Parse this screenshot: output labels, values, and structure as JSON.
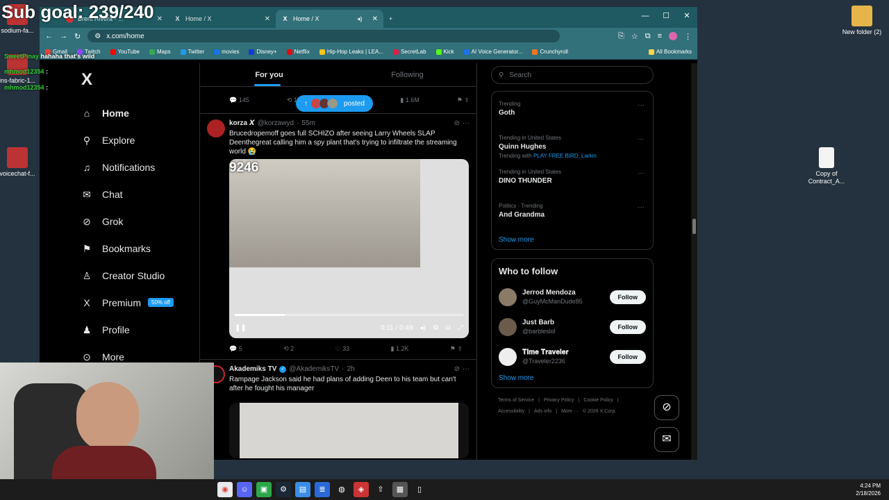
{
  "overlay": {
    "goal": "Sub goal: 239/240",
    "chat": [
      {
        "user": "SweetPinay",
        "msg": "hahaha that's wild"
      },
      {
        "user": "mhmod12354",
        "msg": ":"
      },
      {
        "user": "mhmod12354",
        "msg": ":"
      }
    ]
  },
  "desktop": {
    "icons": [
      "sodium-fa...",
      "ins-fabric-1...",
      "voicechat-f...",
      "New folder (2)",
      "Copy of Contract_A..."
    ]
  },
  "browser": {
    "tabs": [
      {
        "label": "Brent Rivera - ...",
        "active": false
      },
      {
        "label": "Home / X",
        "active": false
      },
      {
        "label": "Home / X",
        "active": true
      }
    ],
    "url": "x.com/home",
    "bookmarks": [
      "Gmail",
      "Twitch",
      "YouTube",
      "Maps",
      "Twitter",
      "movies",
      "Disney+",
      "Netflix",
      "Hip-Hop Leaks | LEA...",
      "SecretLab",
      "Kick",
      "AI Voice Generator...",
      "Crunchyroll",
      "All Bookmarks"
    ],
    "bookmark_colors": [
      "#ea4335",
      "#9146ff",
      "#ff0000",
      "#34a853",
      "#1d9bf0",
      "#1a73e8",
      "#113ccf",
      "#e50914",
      "#f5c518",
      "#e11d48",
      "#53fc18",
      "#1a73e8",
      "#f47521",
      "#ffd54f"
    ]
  },
  "nav": {
    "logo": "X",
    "items": [
      {
        "label": "Home",
        "icon": "home-icon",
        "glyph": "⌂"
      },
      {
        "label": "Explore",
        "icon": "search-icon",
        "glyph": "⚲"
      },
      {
        "label": "Notifications",
        "icon": "bell-icon",
        "glyph": "♫"
      },
      {
        "label": "Chat",
        "icon": "mail-icon",
        "glyph": "✉"
      },
      {
        "label": "Grok",
        "icon": "grok-icon",
        "glyph": "⊘"
      },
      {
        "label": "Bookmarks",
        "icon": "bookmark-icon",
        "glyph": "⚑"
      },
      {
        "label": "Creator Studio",
        "icon": "creator-icon",
        "glyph": "♙"
      },
      {
        "label": "Premium",
        "icon": "x-icon",
        "glyph": "X"
      },
      {
        "label": "Profile",
        "icon": "person-icon",
        "glyph": "♟"
      },
      {
        "label": "More",
        "icon": "more-icon",
        "glyph": "⊙"
      }
    ],
    "premium_badge": "50% off"
  },
  "feed": {
    "tabs": [
      "For you",
      "Following"
    ],
    "top_actions": {
      "replies": "145",
      "reposts": "1",
      "views": "1.6M"
    },
    "posted_pill": "posted",
    "tweets": [
      {
        "name": "korza 𝙓",
        "handle": "@korzawyd",
        "time": "55m",
        "text": "Brucedropemoff goes full SCHIZO after seeing Larry Wheels SLAP Deenthegreat calling him a spy plant that's trying to infiltrate the streaming world 😭",
        "video": {
          "counter": "9246",
          "time": "0:11 / 0:49",
          "progress": 0.22
        },
        "replies": "5",
        "reposts": "2",
        "likes": "33",
        "views": "1.2K"
      },
      {
        "name": "Akademiks TV",
        "handle": "@AkademiksTV",
        "time": "2h",
        "text": "Rampage Jackson said he had plans of adding Deen to his team but can't after he fought his manager"
      }
    ]
  },
  "sidebar": {
    "search_placeholder": "Search",
    "trends": [
      {
        "context": "Trending",
        "name": "Goth",
        "with": ""
      },
      {
        "context": "Trending in United States",
        "name": "Quinn Hughes",
        "with": "Trending with ",
        "links": "PLAY FREE BIRD, Larkin"
      },
      {
        "context": "Trending in United States",
        "name": "DINO THUNDER",
        "with": ""
      },
      {
        "context": "Politics · Trending",
        "name": "And Grandma",
        "with": ""
      }
    ],
    "show_more": "Show more",
    "who_to_follow": {
      "title": "Who to follow",
      "users": [
        {
          "name": "Jerrod Mendoza",
          "handle": "@GuyMcManDude85"
        },
        {
          "name": "Just Barb",
          "handle": "@barbleslol"
        },
        {
          "name": "𝐓𝐢𝐦𝐞 𝐓𝐫𝐚𝐯𝐞𝐥𝐞𝐫",
          "handle": "@Traveler2236"
        }
      ],
      "follow": "Follow",
      "show_more": "Show more"
    },
    "footer": [
      "Terms of Service",
      "|",
      "Privacy Policy",
      "|",
      "Cookie Policy",
      "|",
      "Accessibility",
      "|",
      "Ads info",
      "|",
      "More ···",
      "© 2026 X Corp."
    ]
  },
  "taskbar": {
    "time": "4:24 PM",
    "date": "2/18/2026"
  }
}
